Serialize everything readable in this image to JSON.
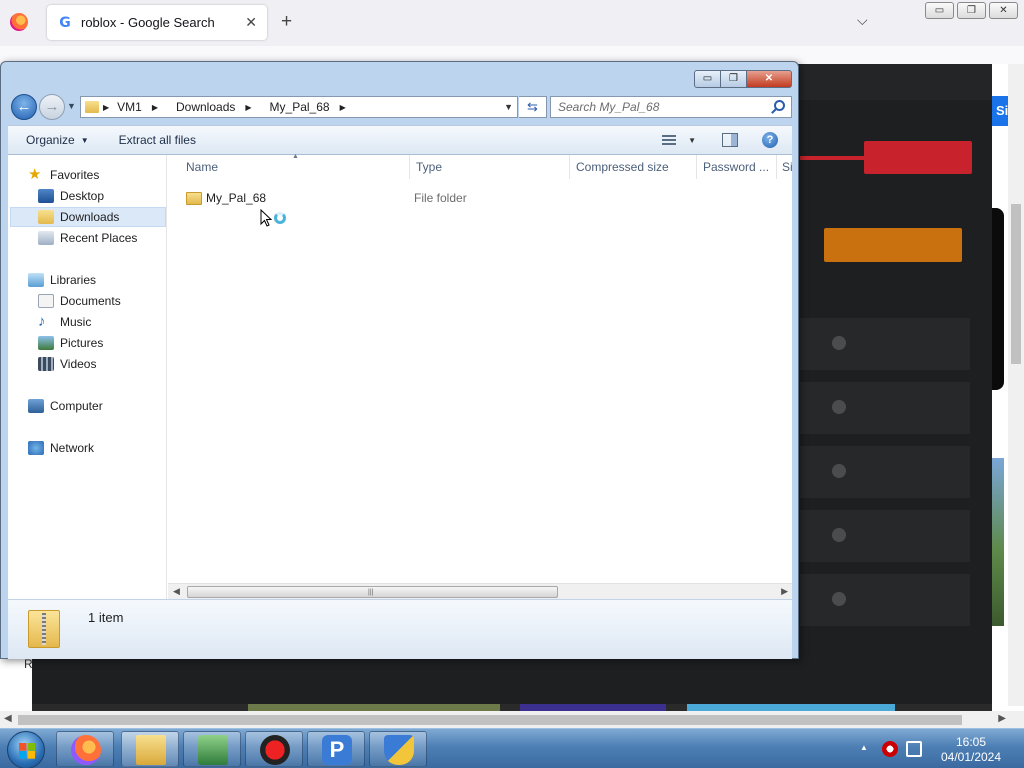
{
  "browser": {
    "tab_title": "roblox - Google Search",
    "tab_close": "✕",
    "new_tab": "+",
    "tab_list": "⌵",
    "page_partial_text": "R",
    "side_button": "Si"
  },
  "explorer": {
    "window_controls": {
      "minimize": "▭",
      "maximize": "❐",
      "close": "✕"
    },
    "breadcrumb": [
      "VM1",
      "Downloads",
      "My_Pal_68"
    ],
    "search_placeholder": "Search My_Pal_68",
    "toolbar": {
      "organize_label": "Organize",
      "extract_label": "Extract all files"
    },
    "nav": {
      "favorites": "Favorites",
      "desktop": "Desktop",
      "downloads": "Downloads",
      "recent_places": "Recent Places",
      "libraries": "Libraries",
      "documents": "Documents",
      "music": "Music",
      "pictures": "Pictures",
      "videos": "Videos",
      "computer": "Computer",
      "network": "Network"
    },
    "columns": {
      "name": "Name",
      "type": "Type",
      "compressed_size": "Compressed size",
      "password": "Password ...",
      "size": "Si"
    },
    "files": [
      {
        "name": "My_Pal_68",
        "type": "File folder"
      }
    ],
    "status": {
      "item_count": "1 item"
    }
  },
  "taskbar": {
    "clock_time": "16:05",
    "clock_date": "04/01/2024"
  },
  "colors": {
    "accent": "#1f5fb0",
    "selection": "#dbe8f8",
    "taskbar": "#4d7fb5"
  }
}
